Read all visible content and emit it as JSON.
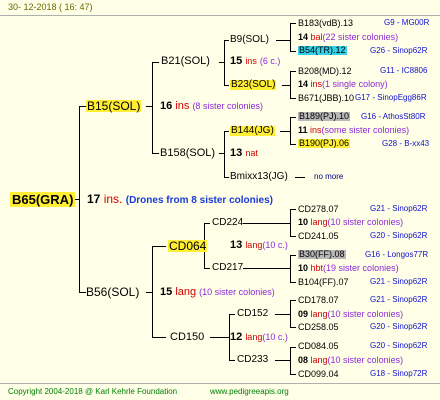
{
  "header": {
    "date": "30-  12-2018  ( 16: 47)"
  },
  "root": {
    "id": "B65(GRA)"
  },
  "root_mate": {
    "num": "17",
    "ins": "ins.",
    "note": "(Drones from 8 sister colonies)"
  },
  "upper": {
    "queen": "B15(SOL)",
    "num": "16",
    "ins": "ins",
    "note": "(8 sister colonies)",
    "b21": {
      "id": "B21(SOL)",
      "num": "15",
      "ins": "ins",
      "note": "(6 c.)"
    },
    "b158": {
      "id": "B158(SOL)",
      "num": "13",
      "ins": "nat"
    },
    "b9": "B9(SOL)",
    "b23": {
      "id": "B23(SOL)",
      "num": "14",
      "ins": "ins",
      "note": "(1 single colony)"
    },
    "b144": {
      "id": "B144(JG)",
      "num": "11",
      "ins": "ins",
      "note": "(some sister colonies)"
    },
    "bmixx": {
      "id": "Bmixx13(JG)",
      "note": "no more"
    },
    "r1": {
      "id": "B183(vdB).13",
      "tag": "G9 - MG00R"
    },
    "r2": {
      "num": "14",
      "ins": "bal",
      "note": "(22 sister colonies)"
    },
    "r3": {
      "id": "B54(TR).12",
      "tag": "G26 - Sinop62R"
    },
    "r4": {
      "id": "B208(MD).12",
      "tag": "G11 - IC8806"
    },
    "r5": {
      "id": "B671(JBB).10",
      "tag": "G17 - SinopEgg86R"
    },
    "r6": {
      "id": "B189(PJ).10",
      "tag": "G16 - AthosSt80R"
    },
    "r7": {
      "id": "B190(PJ).06",
      "tag": "G28 - B-xx43"
    }
  },
  "lower": {
    "queen": "B56(SOL)",
    "num": "15",
    "ins": "lang",
    "note": "(10 sister colonies)",
    "cd064": {
      "id": "CD064",
      "num": "13",
      "ins": "lang",
      "note": "(10 c.)"
    },
    "cd150": {
      "id": "CD150",
      "num": "12",
      "ins": "lang",
      "note": "(10 c.)"
    },
    "cd224": {
      "id": "CD224",
      "num": "10",
      "ins": "lang",
      "note": "(10 sister colonies)"
    },
    "cd217": {
      "id": "CD217",
      "num": "10",
      "ins": "hbt",
      "note": "(19 sister colonies)"
    },
    "cd152": {
      "id": "CD152",
      "num": "09",
      "ins": "lang",
      "note": "(10 sister colonies)"
    },
    "cd233": {
      "id": "CD233",
      "num": "08",
      "ins": "lang",
      "note": "(10 sister colonies)"
    },
    "r1": {
      "id": "CD278.07",
      "tag": "G21 - Sinop62R"
    },
    "r2": {
      "id": "CD241.05",
      "tag": "G20 - Sinop62R"
    },
    "r3": {
      "id": "B30(FF).08",
      "tag": "G16 - Longos77R"
    },
    "r4": {
      "id": "B104(FF).07",
      "tag": "G21 - Sinop62R"
    },
    "r5": {
      "id": "CD178.07",
      "tag": "G21 - Sinop62R"
    },
    "r6": {
      "id": "CD258.05",
      "tag": "G20 - Sinop62R"
    },
    "r7": {
      "id": "CD084.05",
      "tag": "G20 - Sinop62R"
    },
    "r8": {
      "id": "CD099.04",
      "tag": "G18 - Sinop72R"
    }
  },
  "footer": {
    "copyright": "Copyright 2004-2018 @ Karl Kehrle Foundation",
    "url": "www.pedigreeapis.org"
  }
}
